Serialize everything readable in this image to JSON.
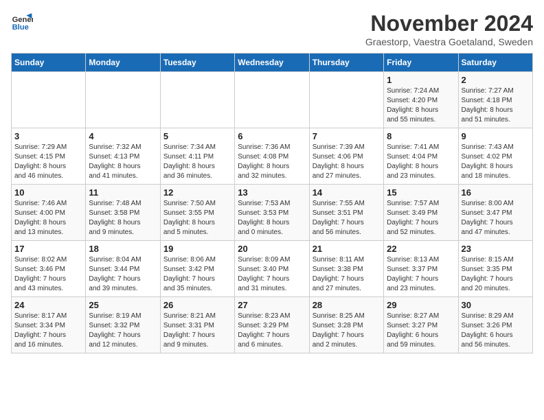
{
  "header": {
    "logo_line1": "General",
    "logo_line2": "Blue",
    "month_title": "November 2024",
    "subtitle": "Graestorp, Vaestra Goetaland, Sweden"
  },
  "weekdays": [
    "Sunday",
    "Monday",
    "Tuesday",
    "Wednesday",
    "Thursday",
    "Friday",
    "Saturday"
  ],
  "weeks": [
    [
      {
        "day": "",
        "info": ""
      },
      {
        "day": "",
        "info": ""
      },
      {
        "day": "",
        "info": ""
      },
      {
        "day": "",
        "info": ""
      },
      {
        "day": "",
        "info": ""
      },
      {
        "day": "1",
        "info": "Sunrise: 7:24 AM\nSunset: 4:20 PM\nDaylight: 8 hours\nand 55 minutes."
      },
      {
        "day": "2",
        "info": "Sunrise: 7:27 AM\nSunset: 4:18 PM\nDaylight: 8 hours\nand 51 minutes."
      }
    ],
    [
      {
        "day": "3",
        "info": "Sunrise: 7:29 AM\nSunset: 4:15 PM\nDaylight: 8 hours\nand 46 minutes."
      },
      {
        "day": "4",
        "info": "Sunrise: 7:32 AM\nSunset: 4:13 PM\nDaylight: 8 hours\nand 41 minutes."
      },
      {
        "day": "5",
        "info": "Sunrise: 7:34 AM\nSunset: 4:11 PM\nDaylight: 8 hours\nand 36 minutes."
      },
      {
        "day": "6",
        "info": "Sunrise: 7:36 AM\nSunset: 4:08 PM\nDaylight: 8 hours\nand 32 minutes."
      },
      {
        "day": "7",
        "info": "Sunrise: 7:39 AM\nSunset: 4:06 PM\nDaylight: 8 hours\nand 27 minutes."
      },
      {
        "day": "8",
        "info": "Sunrise: 7:41 AM\nSunset: 4:04 PM\nDaylight: 8 hours\nand 23 minutes."
      },
      {
        "day": "9",
        "info": "Sunrise: 7:43 AM\nSunset: 4:02 PM\nDaylight: 8 hours\nand 18 minutes."
      }
    ],
    [
      {
        "day": "10",
        "info": "Sunrise: 7:46 AM\nSunset: 4:00 PM\nDaylight: 8 hours\nand 13 minutes."
      },
      {
        "day": "11",
        "info": "Sunrise: 7:48 AM\nSunset: 3:58 PM\nDaylight: 8 hours\nand 9 minutes."
      },
      {
        "day": "12",
        "info": "Sunrise: 7:50 AM\nSunset: 3:55 PM\nDaylight: 8 hours\nand 5 minutes."
      },
      {
        "day": "13",
        "info": "Sunrise: 7:53 AM\nSunset: 3:53 PM\nDaylight: 8 hours\nand 0 minutes."
      },
      {
        "day": "14",
        "info": "Sunrise: 7:55 AM\nSunset: 3:51 PM\nDaylight: 7 hours\nand 56 minutes."
      },
      {
        "day": "15",
        "info": "Sunrise: 7:57 AM\nSunset: 3:49 PM\nDaylight: 7 hours\nand 52 minutes."
      },
      {
        "day": "16",
        "info": "Sunrise: 8:00 AM\nSunset: 3:47 PM\nDaylight: 7 hours\nand 47 minutes."
      }
    ],
    [
      {
        "day": "17",
        "info": "Sunrise: 8:02 AM\nSunset: 3:46 PM\nDaylight: 7 hours\nand 43 minutes."
      },
      {
        "day": "18",
        "info": "Sunrise: 8:04 AM\nSunset: 3:44 PM\nDaylight: 7 hours\nand 39 minutes."
      },
      {
        "day": "19",
        "info": "Sunrise: 8:06 AM\nSunset: 3:42 PM\nDaylight: 7 hours\nand 35 minutes."
      },
      {
        "day": "20",
        "info": "Sunrise: 8:09 AM\nSunset: 3:40 PM\nDaylight: 7 hours\nand 31 minutes."
      },
      {
        "day": "21",
        "info": "Sunrise: 8:11 AM\nSunset: 3:38 PM\nDaylight: 7 hours\nand 27 minutes."
      },
      {
        "day": "22",
        "info": "Sunrise: 8:13 AM\nSunset: 3:37 PM\nDaylight: 7 hours\nand 23 minutes."
      },
      {
        "day": "23",
        "info": "Sunrise: 8:15 AM\nSunset: 3:35 PM\nDaylight: 7 hours\nand 20 minutes."
      }
    ],
    [
      {
        "day": "24",
        "info": "Sunrise: 8:17 AM\nSunset: 3:34 PM\nDaylight: 7 hours\nand 16 minutes."
      },
      {
        "day": "25",
        "info": "Sunrise: 8:19 AM\nSunset: 3:32 PM\nDaylight: 7 hours\nand 12 minutes."
      },
      {
        "day": "26",
        "info": "Sunrise: 8:21 AM\nSunset: 3:31 PM\nDaylight: 7 hours\nand 9 minutes."
      },
      {
        "day": "27",
        "info": "Sunrise: 8:23 AM\nSunset: 3:29 PM\nDaylight: 7 hours\nand 6 minutes."
      },
      {
        "day": "28",
        "info": "Sunrise: 8:25 AM\nSunset: 3:28 PM\nDaylight: 7 hours\nand 2 minutes."
      },
      {
        "day": "29",
        "info": "Sunrise: 8:27 AM\nSunset: 3:27 PM\nDaylight: 6 hours\nand 59 minutes."
      },
      {
        "day": "30",
        "info": "Sunrise: 8:29 AM\nSunset: 3:26 PM\nDaylight: 6 hours\nand 56 minutes."
      }
    ]
  ]
}
